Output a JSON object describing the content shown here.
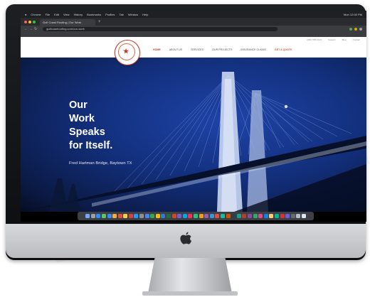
{
  "os_menubar": {
    "items": [
      "Chrome",
      "File",
      "Edit",
      "View",
      "History",
      "Bookmarks",
      "Profiles",
      "Tab",
      "Window",
      "Help"
    ],
    "status": "Mon 12:00 PM"
  },
  "browser": {
    "tab_title": "Gulf Coast Roofing | Our Work",
    "url": "gulfcoastroofing.com/our-work"
  },
  "site": {
    "topbar": {
      "phone": "(281) 555-0123",
      "links": [
        "Careers",
        "Blog",
        "Contact"
      ]
    },
    "nav": {
      "items": [
        "HOME",
        "ABOUT US",
        "SERVICES",
        "OUR PROJECTS",
        "INSURANCE CLAIMS"
      ],
      "cta": "GET A QUOTE"
    },
    "hero": {
      "headline_lines": [
        "Our",
        "Work",
        "Speaks",
        "for Itself."
      ],
      "subline": "Fred Hartman Bridge, Baytown TX"
    }
  },
  "colors": {
    "brand_red": "#c0392b",
    "hero_blue": "#13307e"
  },
  "icons": [
    "apple-logo-icon",
    "dock-app-icons"
  ]
}
